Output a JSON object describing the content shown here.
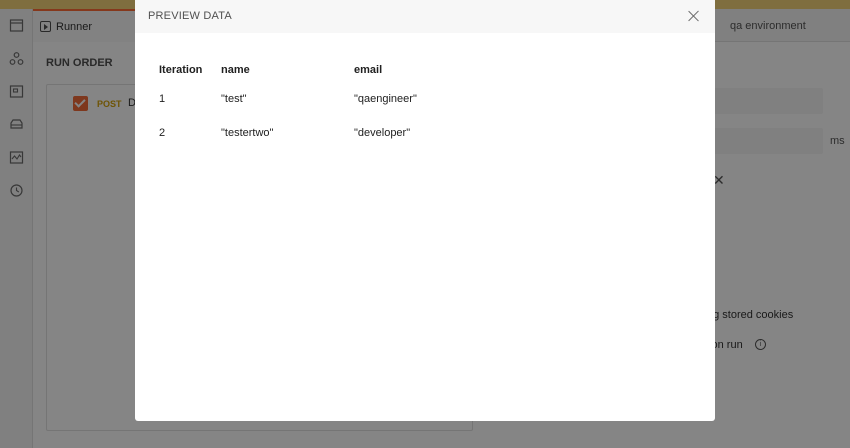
{
  "tabs": {
    "runner_label": "Runner",
    "environment": "qa environment"
  },
  "run_order": {
    "title": "RUN ORDER",
    "requests": [
      {
        "method": "POST",
        "name": "D",
        "checked": true
      }
    ]
  },
  "settings": {
    "ms_unit": "ms",
    "cookies_text": "ng stored cookies",
    "iteration_text": "tion run"
  },
  "modal": {
    "title": "PREVIEW DATA",
    "columns": [
      "Iteration",
      "name",
      "email"
    ],
    "rows": [
      {
        "iteration": "1",
        "name": "\"test\"",
        "email": "\"qaengineer\""
      },
      {
        "iteration": "2",
        "name": "\"testertwo\"",
        "email": "\"developer\""
      }
    ]
  },
  "icons": {
    "sidebar": [
      "collections-icon",
      "apis-icon",
      "environments-icon",
      "mock-servers-icon",
      "monitors-icon",
      "history-icon"
    ]
  },
  "colors": {
    "accent": "#ff6c37",
    "checkbox": "#f26b3a",
    "post_method": "#d4a20b",
    "top_strip": "#f3d37a"
  }
}
